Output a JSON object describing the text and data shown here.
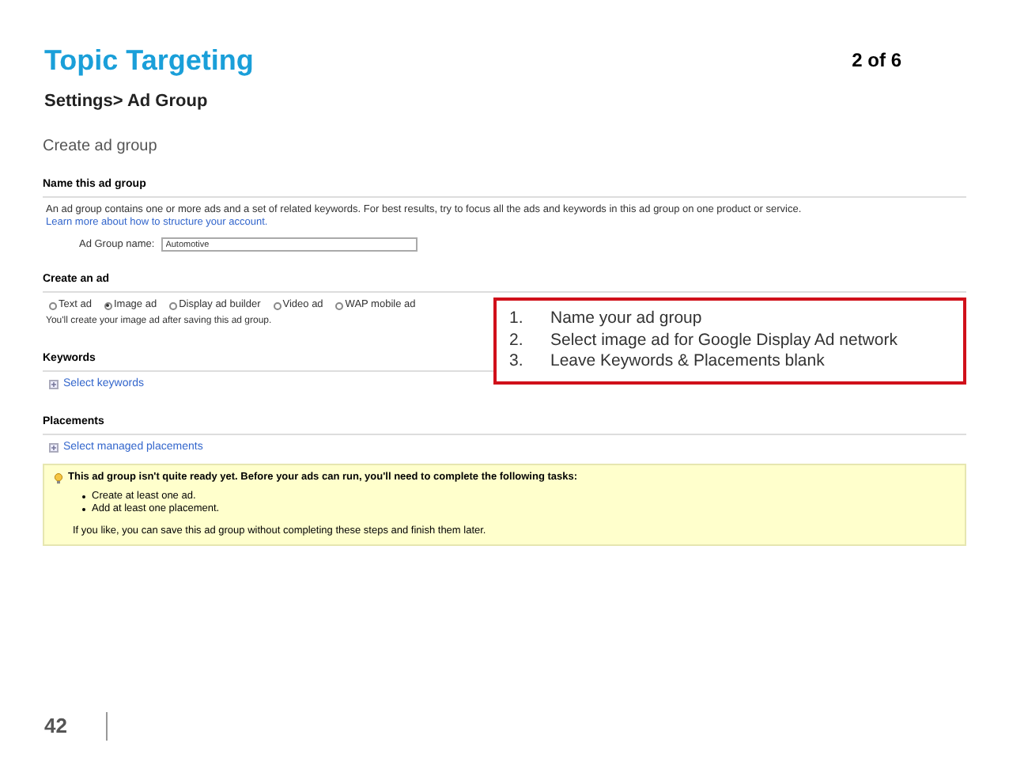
{
  "slide": {
    "title": "Topic Targeting",
    "page": "2 of 6",
    "subtitle": "Settings> Ad Group",
    "number": "42"
  },
  "screen": {
    "heading": "Create ad group",
    "name_section": {
      "title": "Name this ad group",
      "description": "An ad group contains one or more ads and a set of related keywords. For best results, try to focus all the ads and keywords in this ad group on one product or service.",
      "link": "Learn more about how to structure your account.",
      "field_label": "Ad Group name:",
      "field_value": "Automotive"
    },
    "ad_section": {
      "title": "Create an ad",
      "options": [
        {
          "label": "Text ad",
          "selected": false
        },
        {
          "label": "Image ad",
          "selected": true
        },
        {
          "label": "Display ad builder",
          "selected": false
        },
        {
          "label": "Video ad",
          "selected": false
        },
        {
          "label": "WAP mobile ad",
          "selected": false
        }
      ],
      "note": "You'll create your image ad after saving this ad group."
    },
    "keywords": {
      "title": "Keywords",
      "link": "Select keywords"
    },
    "placements": {
      "title": "Placements",
      "link": "Select managed placements"
    },
    "warning": {
      "title": "This ad group isn't quite ready yet. Before your ads can run, you'll need to complete the following tasks:",
      "tasks": [
        "Create at least one ad.",
        "Add at least one placement."
      ],
      "footer": "If you like, you can save this ad group without completing these steps and finish them later."
    }
  },
  "callout": {
    "steps": [
      {
        "num": "1.",
        "text": "Name your ad group"
      },
      {
        "num": "2.",
        "text": "Select image ad for Google Display Ad network"
      },
      {
        "num": "3.",
        "text": "Leave Keywords & Placements blank"
      }
    ]
  }
}
